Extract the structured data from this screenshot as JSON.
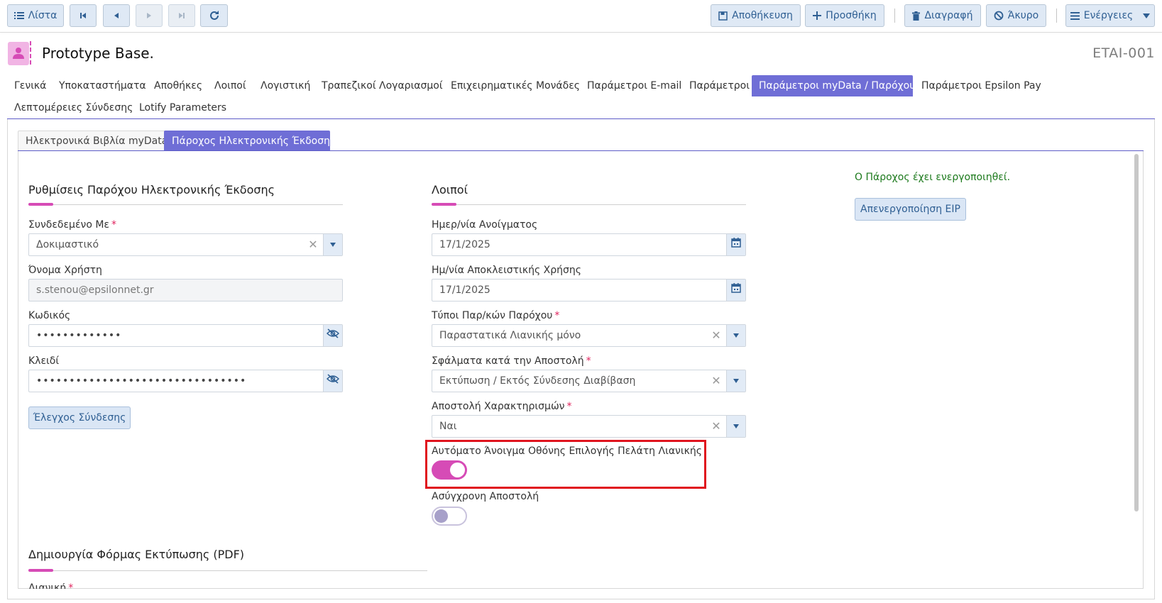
{
  "toolbar": {
    "list_label": "Λίστα",
    "save_label": "Αποθήκευση",
    "add_label": "Προσθήκη",
    "delete_label": "Διαγραφή",
    "cancel_label": "Άκυρο",
    "actions_label": "Ενέργειες"
  },
  "header": {
    "title": "Prototype Base.",
    "code": "ETAI-001"
  },
  "main_tabs": [
    {
      "label": "Γενικά"
    },
    {
      "label": "Υποκαταστήματα"
    },
    {
      "label": "Αποθήκες"
    },
    {
      "label": "Λοιποί"
    },
    {
      "label": "Λογιστική"
    },
    {
      "label": "Τραπεζικοί Λογαριασμοί"
    },
    {
      "label": "Επιχειρηματικές Μονάδες"
    },
    {
      "label": "Παράμετροι E-mail"
    },
    {
      "label": "Παράμετροι"
    },
    {
      "label": "Παράμετροι myData / Παρόχου",
      "active": true
    },
    {
      "label": "Παράμετροι Epsilon Pay"
    },
    {
      "label": "Λεπτομέρειες Σύνδεσης"
    },
    {
      "label": "Lotify Parameters"
    }
  ],
  "sub_tabs": [
    {
      "label": "Ηλεκτρονικά Βιβλία myData"
    },
    {
      "label": "Πάροχος Ηλεκτρονικής Έκδοσης",
      "active": true
    }
  ],
  "provider_settings": {
    "title": "Ρυθμίσεις Παρόχου Ηλεκτρονικής Έκδοσης",
    "connected_with": {
      "label": "Συνδεδεμένο Με",
      "required": "*",
      "value": "Δοκιμαστικό"
    },
    "username": {
      "label": "Όνομα Χρήστη",
      "value": "s.stenou@epsilonnet.gr"
    },
    "password": {
      "label": "Κωδικός",
      "value": "•••••••••••••"
    },
    "key": {
      "label": "Κλειδί",
      "value": "••••••••••••••••••••••••••••••••"
    },
    "test_connection_label": "Έλεγχος Σύνδεσης"
  },
  "others": {
    "title": "Λοιποί",
    "opening_date": {
      "label": "Ημερ/νία Ανοίγματος",
      "value": "17/1/2025"
    },
    "exclusive_use_date": {
      "label": "Ημ/νία Αποκλειστικής Χρήσης",
      "value": "17/1/2025"
    },
    "provider_doc_types": {
      "label": "Τύποι Παρ/κών Παρόχου",
      "required": "*",
      "value": "Παραστατικά Λιανικής μόνο"
    },
    "send_errors": {
      "label": "Σφάλματα κατά την Αποστολή",
      "required": "*",
      "value": "Εκτύπωση / Εκτός Σύνδεσης Διαβίβαση"
    },
    "send_classifications": {
      "label": "Αποστολή Χαρακτηρισμών",
      "required": "*",
      "value": "Ναι"
    },
    "auto_open_customer": {
      "label": "Αυτόματο Άνοιγμα Οθόνης Επιλογής Πελάτη Λιανικής",
      "state": "on"
    },
    "async_send": {
      "label": "Ασύγχρονη Αποστολή",
      "state": "off"
    }
  },
  "status": {
    "text": "Ο Πάροχος έχει ενεργοποιηθεί.",
    "deactivate_label": "Απενεργοποίηση EIP"
  },
  "pdf_section": {
    "title": "Δημιουργία Φόρμας Εκτύπωσης (PDF)",
    "retail_label": "Λιανική",
    "required": "*"
  },
  "colors": {
    "accent": "#6f6ed6",
    "pink": "#d64bb6",
    "highlight": "#e0141e",
    "status_green": "#1d7a1d"
  }
}
